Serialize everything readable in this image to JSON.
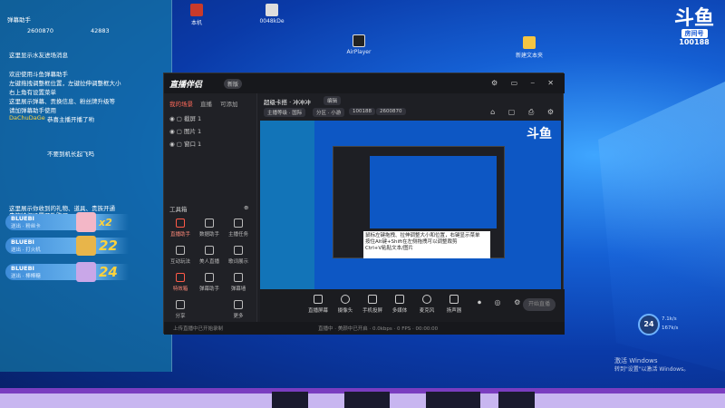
{
  "desktop": {
    "icons_top": [
      "弹幕助手",
      "",
      "",
      "",
      "",
      "",
      "",
      "本机",
      "",
      "",
      "",
      "",
      "",
      "",
      "",
      "0048kDe"
    ],
    "icon_aircap": "AirPlayer",
    "icon_newfolder": "新建文本夹"
  },
  "chat": {
    "header": {
      "title": "弹幕助手",
      "stat1": "2600870",
      "stat2": "42883"
    },
    "welcome": "这里显示水友进场消息",
    "intro": [
      "欢迎使用斗鱼弹幕助手",
      "左键拖拽调整框位置，左键拉伸调整框大小",
      "右上角有设置菜单",
      "这里展示弹幕、贡换信息、粉丝牌升级等",
      "请加弹幕助手使用"
    ],
    "entries": [
      {
        "user": "DaChuDaGe",
        "text": "恭喜主播开播了哟",
        "yellow": true
      },
      {
        "user": "",
        "text": "不要到机长起飞吗",
        "yellow": false
      }
    ],
    "gift_notice": "这里展示你收到的礼物、道具、贵族开通",
    "gift_notice2": "贵族特权设置开放购买",
    "gifts": [
      {
        "user": "BLUEBI",
        "line2": "送出 · 粉丝卡",
        "count": "x2"
      },
      {
        "user": "BLUEBI",
        "line2": "送出 · 打火机",
        "count": "22"
      },
      {
        "user": "BLUEBI",
        "line2": "送出 · 棒棒糖",
        "count": "24"
      }
    ]
  },
  "window": {
    "logo": "直播伴侣",
    "version": "新版",
    "tabs": [
      "我的场景",
      "直播",
      "可添加"
    ],
    "scenes": [
      "截屏 1",
      "图片 1",
      "窗口 1"
    ],
    "room_title": "超级卡搭 · 冲冲冲",
    "room_edit": "编辑",
    "pills": [
      "主播等级 · 国际",
      "分区 · 小游",
      "100188",
      "2600870"
    ],
    "tools": [
      "直播助手",
      "数据助手",
      "主播任务",
      "互动玩法",
      "美人直播",
      "歌词展示",
      "特效箱",
      "弹幕助手",
      "弹幕墙",
      "分享",
      "更多"
    ],
    "tools_title": "工具箱",
    "controls": [
      "直播屏幕",
      "摄像头",
      "手机投屏",
      "多媒体",
      "麦克风",
      "扬声器"
    ],
    "start_label": "开始直播",
    "status_text": "直播中 · 美颜中已开启 · 0.0kbps · 0 FPS · 00:00:00",
    "footer_hint": "上传直播中已开始录制",
    "tooltip": "鼠标左键拖拽、拉伸调整大小和位置，右键显示菜单\n按住Alt键+Shift在左侧拖拽可以调整裁剪\nCtrl+V粘贴文本/图片"
  },
  "brand": {
    "site": "斗鱼",
    "tag": "房间号",
    "room": "100188"
  },
  "network": {
    "percent": "24",
    "up": "7.1k/s",
    "down": "167k/s"
  },
  "watermark": {
    "line1": "激活 Windows",
    "line2": "转到\"设置\"以激活 Windows。"
  }
}
